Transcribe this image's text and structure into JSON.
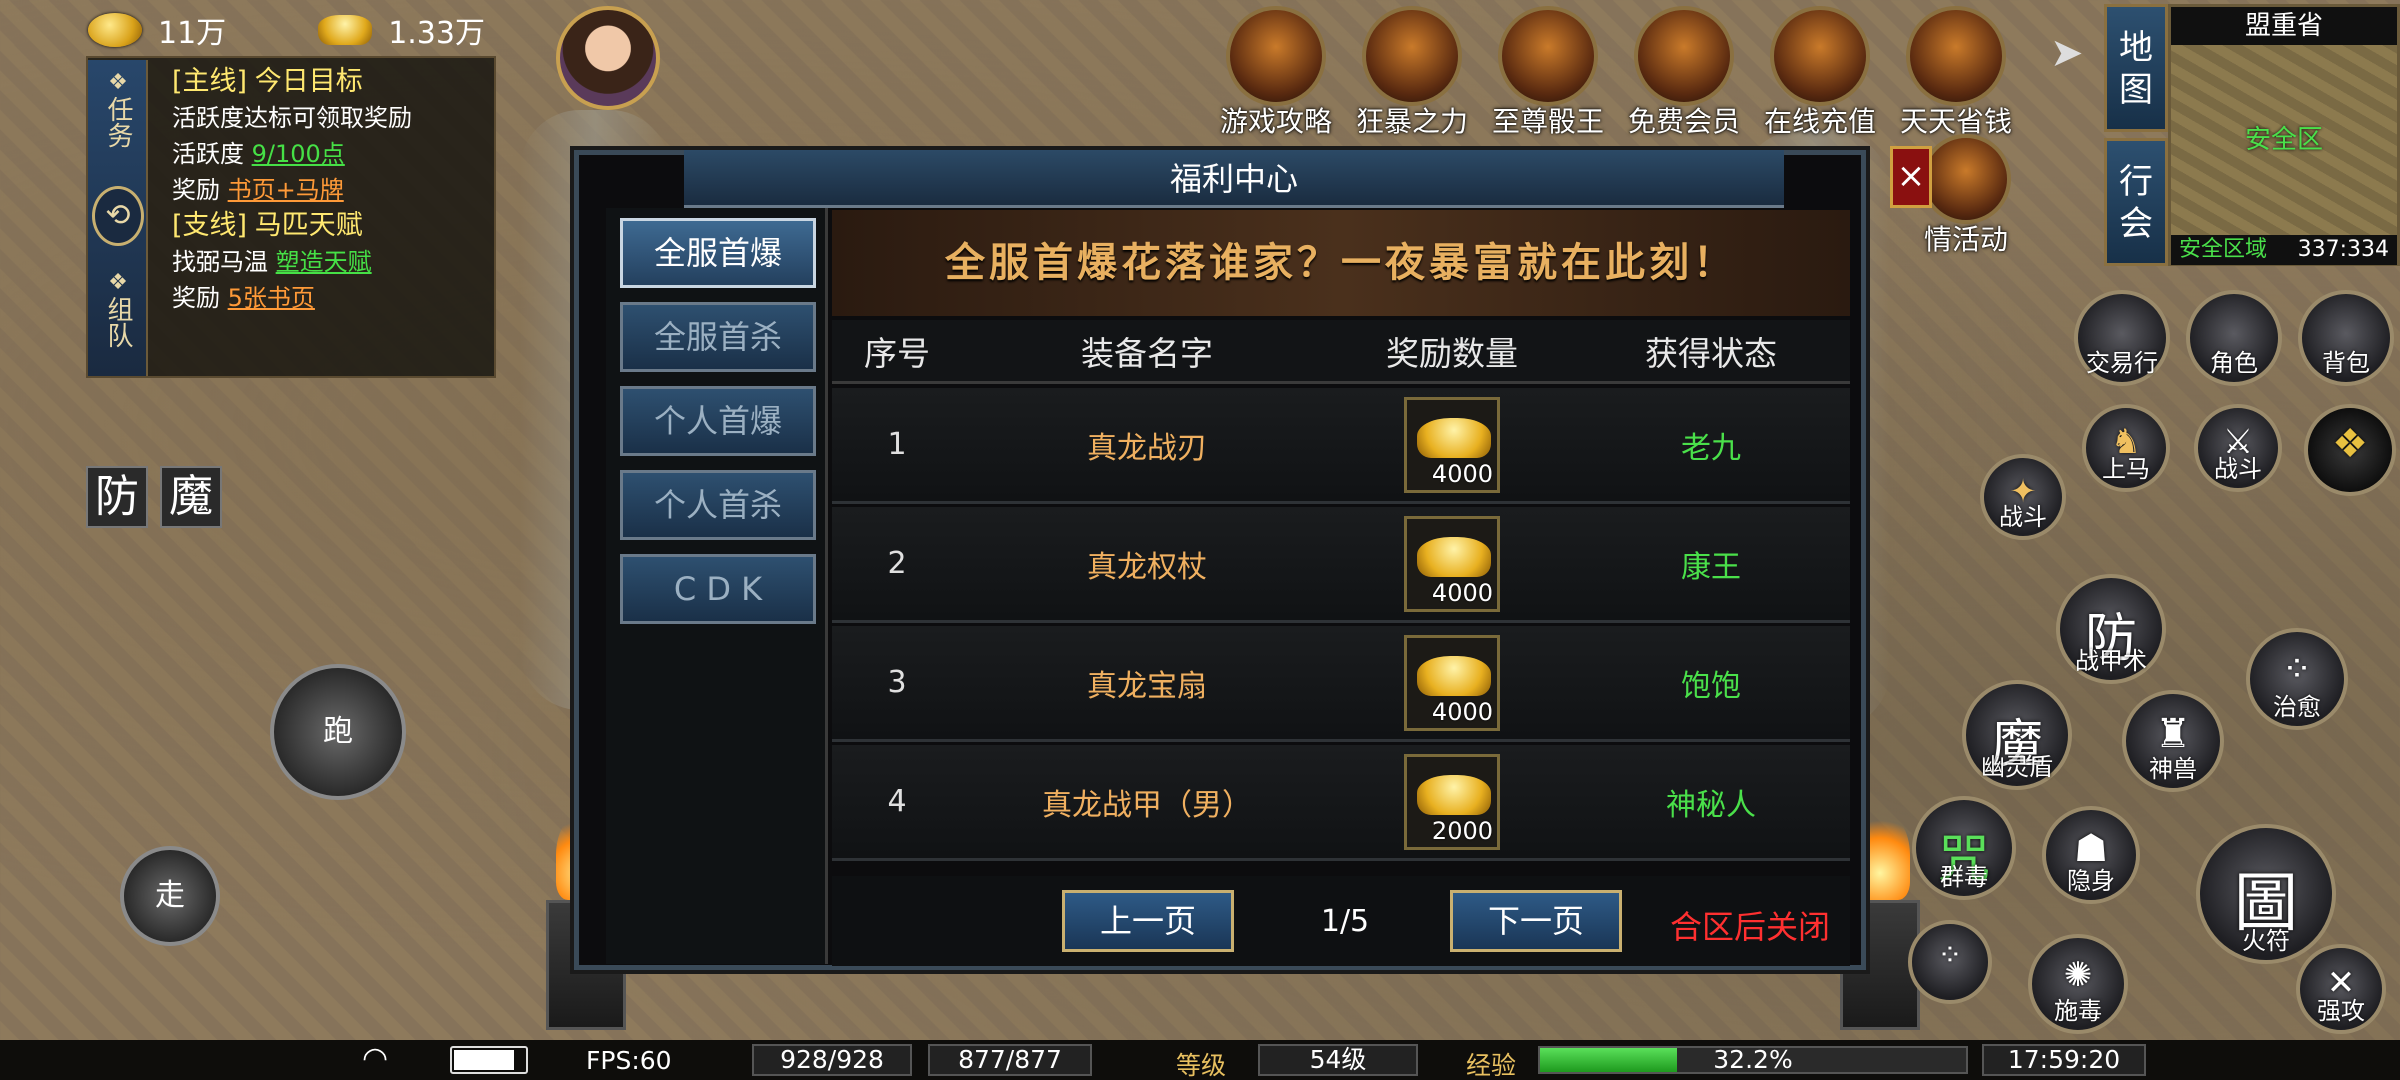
{
  "currency": {
    "gold": "11万",
    "ingot": "1.33万"
  },
  "quest_panel": {
    "tabs": [
      "任务",
      "组队"
    ],
    "quests": [
      {
        "tag": "[主线]",
        "title": "今日目标",
        "line1": "活跃度达标可领取奖励",
        "line2_label": "活跃度",
        "line2_value": "9/100点",
        "reward_label": "奖励",
        "reward_value": "书页+马牌"
      },
      {
        "tag": "[支线]",
        "title": "马匹天赋",
        "line1_label": "找弼马温",
        "line1_value": "塑造天赋",
        "reward_label": "奖励",
        "reward_value": "5张书页"
      }
    ]
  },
  "skill_tags": [
    "防",
    "魔"
  ],
  "top_icons": [
    {
      "name": "guide",
      "label": "游戏攻略"
    },
    {
      "name": "rage",
      "label": "狂暴之力"
    },
    {
      "name": "supreme",
      "label": "至尊骰王"
    },
    {
      "name": "vip",
      "label": "免费会员"
    },
    {
      "name": "recharge",
      "label": "在线充值"
    },
    {
      "name": "save",
      "label": "天天省钱"
    },
    {
      "name": "event",
      "label": "情活动"
    }
  ],
  "map": {
    "btn1": "地图",
    "btn2": "行会",
    "region": "盟重省",
    "zone": "安全区",
    "zone_footer": "安全区域",
    "coords": "337:334"
  },
  "right_buttons": [
    {
      "name": "trade",
      "label": "交易行"
    },
    {
      "name": "role",
      "label": "角色"
    },
    {
      "name": "bag",
      "label": "背包"
    },
    {
      "name": "mount",
      "label": "上马"
    },
    {
      "name": "fight-small",
      "label": "战斗"
    },
    {
      "name": "fight",
      "label": "战斗"
    }
  ],
  "skills": [
    {
      "glyph": "防",
      "label": "战甲术"
    },
    {
      "glyph": "",
      "label": "治愈"
    },
    {
      "glyph": "魔",
      "label": "幽灵盾"
    },
    {
      "glyph": "",
      "label": "神兽"
    },
    {
      "glyph": "咒",
      "label": "群毒"
    },
    {
      "glyph": "",
      "label": "隐身"
    },
    {
      "glyph": "圖",
      "label": "火符"
    },
    {
      "glyph": "",
      "label": "施毒"
    },
    {
      "glyph": "",
      "label": "强攻"
    }
  ],
  "controls": {
    "run": "跑",
    "walk": "走"
  },
  "dialog": {
    "title": "福利中心",
    "nav": [
      "全服首爆",
      "全服首杀",
      "个人首爆",
      "个人首杀",
      "C D K"
    ],
    "active_nav": 0,
    "banner": "全服首爆花落谁家？一夜暴富就在此刻！",
    "columns": [
      "序号",
      "装备名字",
      "奖励数量",
      "获得状态"
    ],
    "rows": [
      {
        "index": "1",
        "item": "真龙战刃",
        "amount": "4000",
        "status": "老九"
      },
      {
        "index": "2",
        "item": "真龙权杖",
        "amount": "4000",
        "status": "康王"
      },
      {
        "index": "3",
        "item": "真龙宝扇",
        "amount": "4000",
        "status": "饱饱"
      },
      {
        "index": "4",
        "item": "真龙战甲（男）",
        "amount": "2000",
        "status": "神秘人"
      }
    ],
    "prev": "上一页",
    "page": "1/5",
    "next": "下一页",
    "notice": "合区后关闭",
    "close": "×"
  },
  "status_bar": {
    "fps": "FPS:60",
    "hp": "928/928",
    "mp": "877/877",
    "level_label": "等级",
    "level": "54级",
    "exp_label": "经验",
    "exp": "32.2%",
    "exp_fraction": 0.322,
    "time": "17:59:20"
  },
  "colors": {
    "accent_gold": "#e8b060",
    "status_green": "#4ae04a",
    "notice_red": "#ff3030"
  }
}
